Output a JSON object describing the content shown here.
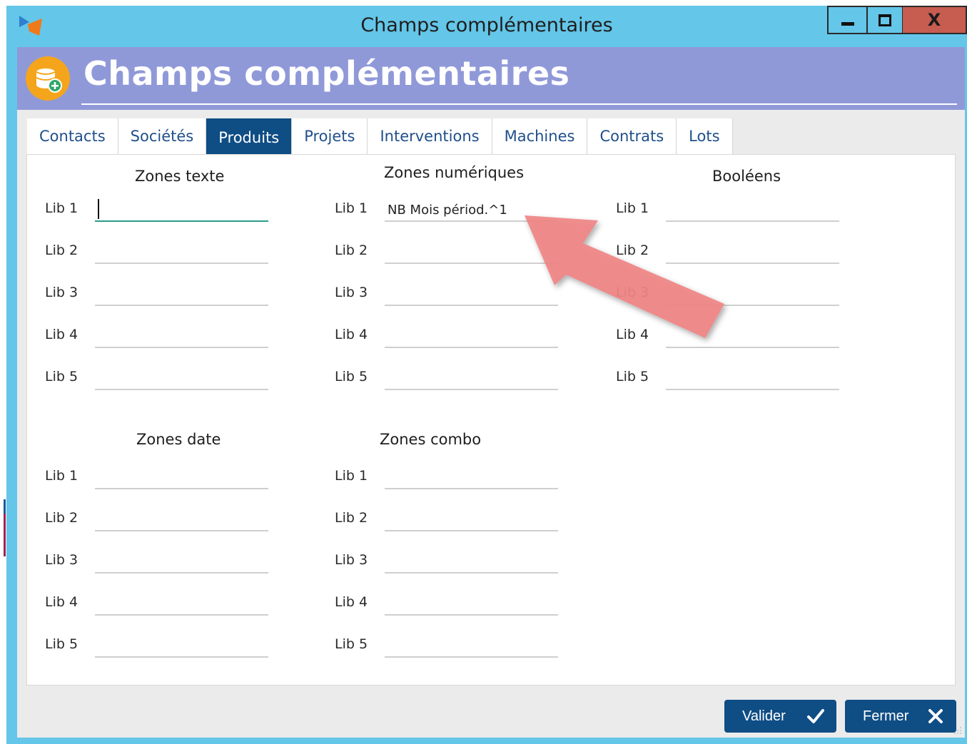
{
  "window": {
    "title": "Champs complémentaires",
    "close_label": "X"
  },
  "header": {
    "title": "Champs complémentaires",
    "icon": "database-add-icon"
  },
  "tabs": [
    {
      "label": "Contacts",
      "active": false
    },
    {
      "label": "Sociétés",
      "active": false
    },
    {
      "label": "Produits",
      "active": true
    },
    {
      "label": "Projets",
      "active": false
    },
    {
      "label": "Interventions",
      "active": false
    },
    {
      "label": "Machines",
      "active": false
    },
    {
      "label": "Contrats",
      "active": false
    },
    {
      "label": "Lots",
      "active": false
    }
  ],
  "groups": {
    "texte": {
      "title": "Zones texte",
      "fields": [
        {
          "label": "Lib 1",
          "value": ""
        },
        {
          "label": "Lib 2",
          "value": ""
        },
        {
          "label": "Lib 3",
          "value": ""
        },
        {
          "label": "Lib 4",
          "value": ""
        },
        {
          "label": "Lib 5",
          "value": ""
        }
      ]
    },
    "numeriques": {
      "title": "Zones numériques",
      "fields": [
        {
          "label": "Lib 1",
          "value": "NB Mois périod.^1"
        },
        {
          "label": "Lib 2",
          "value": ""
        },
        {
          "label": "Lib 3",
          "value": ""
        },
        {
          "label": "Lib 4",
          "value": ""
        },
        {
          "label": "Lib 5",
          "value": ""
        }
      ]
    },
    "booleens": {
      "title": "Booléens",
      "fields": [
        {
          "label": "Lib 1",
          "value": ""
        },
        {
          "label": "Lib 2",
          "value": ""
        },
        {
          "label": "Lib 3",
          "value": ""
        },
        {
          "label": "Lib 4",
          "value": ""
        },
        {
          "label": "Lib 5",
          "value": ""
        }
      ]
    },
    "date": {
      "title": "Zones date",
      "fields": [
        {
          "label": "Lib 1",
          "value": ""
        },
        {
          "label": "Lib 2",
          "value": ""
        },
        {
          "label": "Lib 3",
          "value": ""
        },
        {
          "label": "Lib 4",
          "value": ""
        },
        {
          "label": "Lib 5",
          "value": ""
        }
      ]
    },
    "combo": {
      "title": "Zones combo",
      "fields": [
        {
          "label": "Lib 1",
          "value": ""
        },
        {
          "label": "Lib 2",
          "value": ""
        },
        {
          "label": "Lib 3",
          "value": ""
        },
        {
          "label": "Lib 4",
          "value": ""
        },
        {
          "label": "Lib 5",
          "value": ""
        }
      ]
    }
  },
  "actions": {
    "valider_label": "Valider",
    "fermer_label": "Fermer"
  },
  "colors": {
    "titlebar": "#64c6e8",
    "header_band": "#9099d8",
    "accent": "#0f4d85",
    "annotation_arrow": "#f08080"
  }
}
